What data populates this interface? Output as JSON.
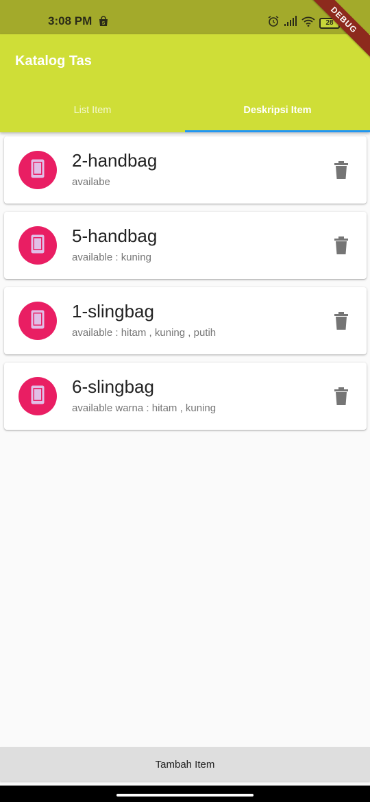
{
  "status_bar": {
    "time": "3:08 PM",
    "battery": "28",
    "icons": [
      "shopping-bag-icon",
      "alarm-icon",
      "signal-icon",
      "wifi-icon",
      "battery-icon"
    ]
  },
  "debug_banner": "DEBUG",
  "app_bar": {
    "title": "Katalog Tas",
    "tabs": [
      {
        "label": "List Item",
        "active": false
      },
      {
        "label": "Deskripsi Item",
        "active": true
      }
    ]
  },
  "colors": {
    "status_bar": "#a3aa2b",
    "app_bar": "#cfde37",
    "tab_indicator": "#2196f3",
    "avatar": "#e91e63",
    "avatar_icon": "#e1bee7",
    "delete_icon": "#757575"
  },
  "items": [
    {
      "title": "2-handbag",
      "subtitle": "availabe",
      "icon": "phone-icon"
    },
    {
      "title": "5-handbag",
      "subtitle": "available : kuning",
      "icon": "phone-icon"
    },
    {
      "title": "1-slingbag",
      "subtitle": "available : hitam , kuning , putih",
      "icon": "phone-icon"
    },
    {
      "title": "6-slingbag",
      "subtitle": "available warna : hitam , kuning",
      "icon": "phone-icon"
    }
  ],
  "bottom_button": {
    "label": "Tambah Item"
  }
}
